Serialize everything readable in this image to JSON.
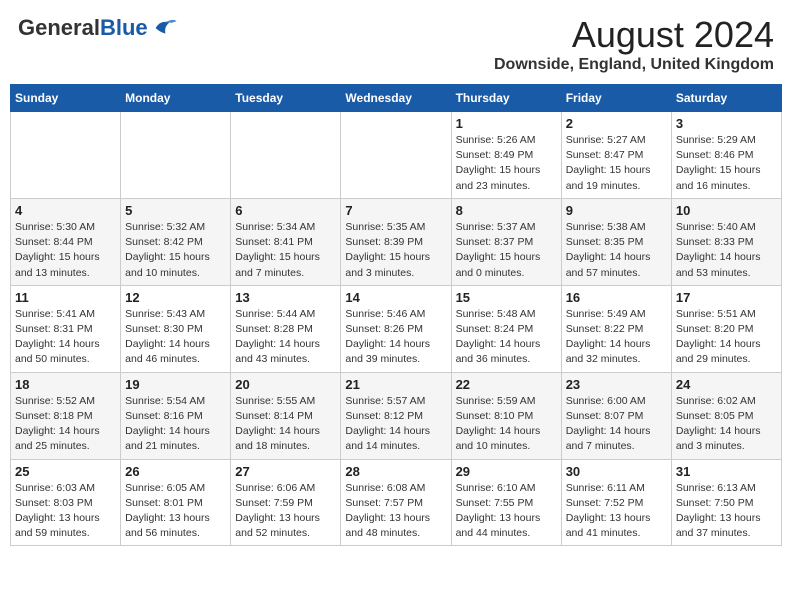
{
  "header": {
    "logo_general": "General",
    "logo_blue": "Blue",
    "title": "August 2024",
    "location": "Downside, England, United Kingdom"
  },
  "days_of_week": [
    "Sunday",
    "Monday",
    "Tuesday",
    "Wednesday",
    "Thursday",
    "Friday",
    "Saturday"
  ],
  "weeks": [
    [
      {
        "day": "",
        "info": ""
      },
      {
        "day": "",
        "info": ""
      },
      {
        "day": "",
        "info": ""
      },
      {
        "day": "",
        "info": ""
      },
      {
        "day": "1",
        "info": "Sunrise: 5:26 AM\nSunset: 8:49 PM\nDaylight: 15 hours\nand 23 minutes."
      },
      {
        "day": "2",
        "info": "Sunrise: 5:27 AM\nSunset: 8:47 PM\nDaylight: 15 hours\nand 19 minutes."
      },
      {
        "day": "3",
        "info": "Sunrise: 5:29 AM\nSunset: 8:46 PM\nDaylight: 15 hours\nand 16 minutes."
      }
    ],
    [
      {
        "day": "4",
        "info": "Sunrise: 5:30 AM\nSunset: 8:44 PM\nDaylight: 15 hours\nand 13 minutes."
      },
      {
        "day": "5",
        "info": "Sunrise: 5:32 AM\nSunset: 8:42 PM\nDaylight: 15 hours\nand 10 minutes."
      },
      {
        "day": "6",
        "info": "Sunrise: 5:34 AM\nSunset: 8:41 PM\nDaylight: 15 hours\nand 7 minutes."
      },
      {
        "day": "7",
        "info": "Sunrise: 5:35 AM\nSunset: 8:39 PM\nDaylight: 15 hours\nand 3 minutes."
      },
      {
        "day": "8",
        "info": "Sunrise: 5:37 AM\nSunset: 8:37 PM\nDaylight: 15 hours\nand 0 minutes."
      },
      {
        "day": "9",
        "info": "Sunrise: 5:38 AM\nSunset: 8:35 PM\nDaylight: 14 hours\nand 57 minutes."
      },
      {
        "day": "10",
        "info": "Sunrise: 5:40 AM\nSunset: 8:33 PM\nDaylight: 14 hours\nand 53 minutes."
      }
    ],
    [
      {
        "day": "11",
        "info": "Sunrise: 5:41 AM\nSunset: 8:31 PM\nDaylight: 14 hours\nand 50 minutes."
      },
      {
        "day": "12",
        "info": "Sunrise: 5:43 AM\nSunset: 8:30 PM\nDaylight: 14 hours\nand 46 minutes."
      },
      {
        "day": "13",
        "info": "Sunrise: 5:44 AM\nSunset: 8:28 PM\nDaylight: 14 hours\nand 43 minutes."
      },
      {
        "day": "14",
        "info": "Sunrise: 5:46 AM\nSunset: 8:26 PM\nDaylight: 14 hours\nand 39 minutes."
      },
      {
        "day": "15",
        "info": "Sunrise: 5:48 AM\nSunset: 8:24 PM\nDaylight: 14 hours\nand 36 minutes."
      },
      {
        "day": "16",
        "info": "Sunrise: 5:49 AM\nSunset: 8:22 PM\nDaylight: 14 hours\nand 32 minutes."
      },
      {
        "day": "17",
        "info": "Sunrise: 5:51 AM\nSunset: 8:20 PM\nDaylight: 14 hours\nand 29 minutes."
      }
    ],
    [
      {
        "day": "18",
        "info": "Sunrise: 5:52 AM\nSunset: 8:18 PM\nDaylight: 14 hours\nand 25 minutes."
      },
      {
        "day": "19",
        "info": "Sunrise: 5:54 AM\nSunset: 8:16 PM\nDaylight: 14 hours\nand 21 minutes."
      },
      {
        "day": "20",
        "info": "Sunrise: 5:55 AM\nSunset: 8:14 PM\nDaylight: 14 hours\nand 18 minutes."
      },
      {
        "day": "21",
        "info": "Sunrise: 5:57 AM\nSunset: 8:12 PM\nDaylight: 14 hours\nand 14 minutes."
      },
      {
        "day": "22",
        "info": "Sunrise: 5:59 AM\nSunset: 8:10 PM\nDaylight: 14 hours\nand 10 minutes."
      },
      {
        "day": "23",
        "info": "Sunrise: 6:00 AM\nSunset: 8:07 PM\nDaylight: 14 hours\nand 7 minutes."
      },
      {
        "day": "24",
        "info": "Sunrise: 6:02 AM\nSunset: 8:05 PM\nDaylight: 14 hours\nand 3 minutes."
      }
    ],
    [
      {
        "day": "25",
        "info": "Sunrise: 6:03 AM\nSunset: 8:03 PM\nDaylight: 13 hours\nand 59 minutes."
      },
      {
        "day": "26",
        "info": "Sunrise: 6:05 AM\nSunset: 8:01 PM\nDaylight: 13 hours\nand 56 minutes."
      },
      {
        "day": "27",
        "info": "Sunrise: 6:06 AM\nSunset: 7:59 PM\nDaylight: 13 hours\nand 52 minutes."
      },
      {
        "day": "28",
        "info": "Sunrise: 6:08 AM\nSunset: 7:57 PM\nDaylight: 13 hours\nand 48 minutes."
      },
      {
        "day": "29",
        "info": "Sunrise: 6:10 AM\nSunset: 7:55 PM\nDaylight: 13 hours\nand 44 minutes."
      },
      {
        "day": "30",
        "info": "Sunrise: 6:11 AM\nSunset: 7:52 PM\nDaylight: 13 hours\nand 41 minutes."
      },
      {
        "day": "31",
        "info": "Sunrise: 6:13 AM\nSunset: 7:50 PM\nDaylight: 13 hours\nand 37 minutes."
      }
    ]
  ]
}
